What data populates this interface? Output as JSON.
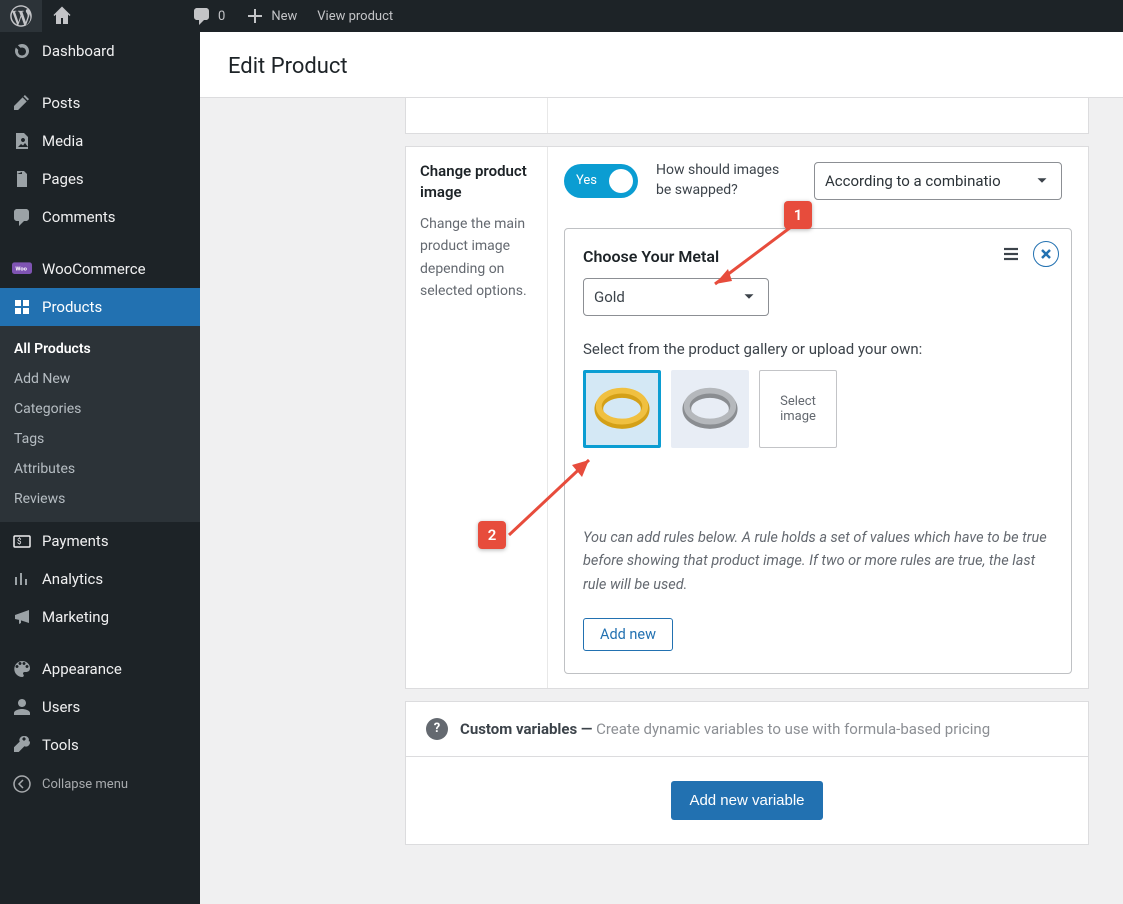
{
  "topbar": {
    "comments_count": "0",
    "new_label": "New",
    "view_product": "View product"
  },
  "sidebar": {
    "dashboard": "Dashboard",
    "posts": "Posts",
    "media": "Media",
    "pages": "Pages",
    "comments": "Comments",
    "woocommerce": "WooCommerce",
    "products": "Products",
    "products_sub": {
      "all": "All Products",
      "add": "Add New",
      "categories": "Categories",
      "tags": "Tags",
      "attributes": "Attributes",
      "reviews": "Reviews"
    },
    "payments": "Payments",
    "analytics": "Analytics",
    "marketing": "Marketing",
    "appearance": "Appearance",
    "users": "Users",
    "tools": "Tools",
    "collapse": "Collapse menu"
  },
  "header": {
    "title": "Edit Product"
  },
  "change_image": {
    "title": "Change product image",
    "desc": "Change the main product image depending on selected options.",
    "toggle_text": "Yes",
    "swap_label": "How should images be swapped?",
    "combo_text": "According to a combinatio"
  },
  "card": {
    "title": "Choose Your Metal",
    "select_value": "Gold",
    "gallery_label": "Select from the product gallery or upload your own:",
    "upload_text": "Select image",
    "rules_text": "You can add rules below. A rule holds a set of values which have to be true before showing that product image. If two or more rules are true, the last rule will be used.",
    "add_new": "Add new"
  },
  "custom_vars": {
    "lead": "Custom variables — ",
    "grey": "Create dynamic variables to use with formula-based pricing"
  },
  "add_variable": "Add new variable",
  "annotations": {
    "b1": "1",
    "b2": "2"
  }
}
